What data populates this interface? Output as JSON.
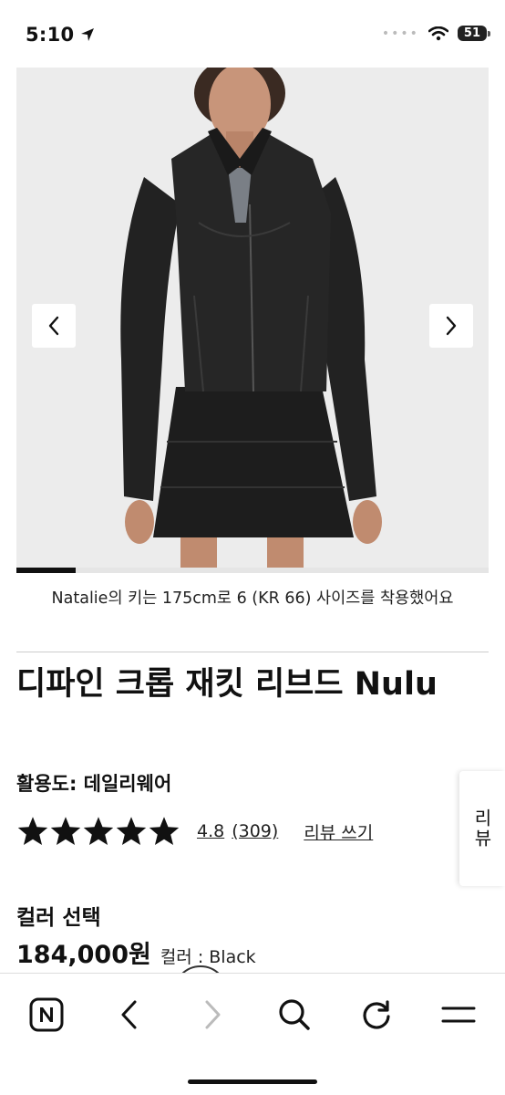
{
  "status_bar": {
    "time": "5:10",
    "battery": "51"
  },
  "carousel": {
    "prev_icon": "chevron-left-icon",
    "next_icon": "chevron-right-icon",
    "progress_fraction": 0.125
  },
  "caption": "Natalie의 키는 175cm로 6 (KR 66) 사이즈를 착용했어요",
  "product": {
    "title": "디파인 크롭 재킷 리브드 Nulu",
    "activity": "활용도: 데일리웨어",
    "rating_value": "4.8",
    "review_count": "(309)",
    "review_write": "리뷰 쓰기",
    "stars": 5,
    "color_select_label": "컬러 선택",
    "price": "184,000원",
    "color_text": "컬러 : Black"
  },
  "side_tab": {
    "label": "리뷰"
  },
  "toolbar": {
    "items": [
      "naver-logo-icon",
      "back-arrow-icon",
      "forward-arrow-icon",
      "search-icon",
      "refresh-icon",
      "menu-icon"
    ]
  }
}
